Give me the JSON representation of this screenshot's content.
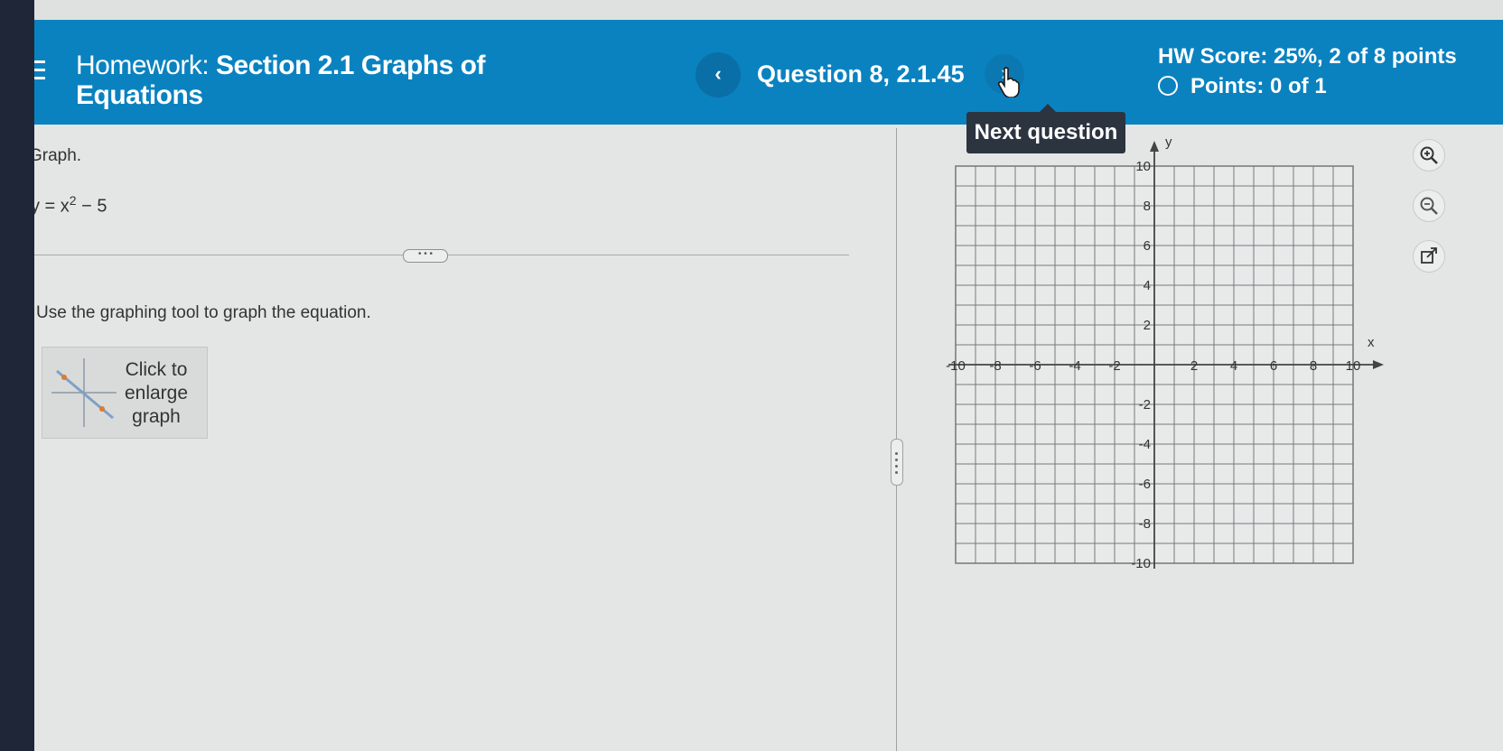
{
  "header": {
    "title_label": "Homework:",
    "title_text": "Section 2.1 Graphs of",
    "title_text2": "Equations",
    "prev_label": "‹",
    "question": "Question 8, 2.1.45",
    "next_label": "›",
    "score": "HW Score: 25%, 2 of 8 points",
    "points": "Points: 0 of 1",
    "tooltip": "Next question"
  },
  "problem": {
    "prompt": "Graph.",
    "equation_base": "y = x",
    "equation_exp": "2",
    "equation_tail": " − 5",
    "more_label": "• • •",
    "instructions": "Use the graphing tool to graph the equation.",
    "thumbnail_text": [
      "Click to",
      "enlarge",
      "graph"
    ]
  },
  "graph": {
    "x_label": "x",
    "y_label": "y",
    "x_range": [
      -10,
      10
    ],
    "y_range": [
      -10,
      10
    ],
    "grid_step": 1,
    "x_ticks": [
      "-10",
      "-8",
      "-6",
      "-4",
      "-2",
      "2",
      "4",
      "6",
      "8",
      "10"
    ],
    "y_ticks": [
      "10",
      "8",
      "6",
      "4",
      "2",
      "-2",
      "-4",
      "-6",
      "-8",
      "-10"
    ]
  },
  "side_tools": [
    "zoom-in-icon",
    "zoom-out-icon",
    "external-link-icon"
  ],
  "colors": {
    "header": "#0a82c0",
    "tooltip": "#2c3440",
    "background": "#e4e6e5"
  }
}
